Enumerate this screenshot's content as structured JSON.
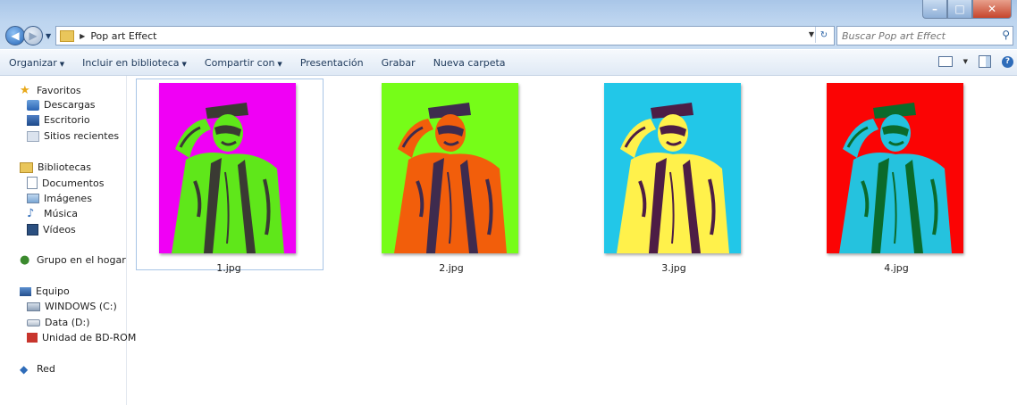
{
  "address": {
    "path": "Pop art Effect"
  },
  "search": {
    "placeholder": "Buscar Pop art Effect"
  },
  "toolbar": {
    "organize": "Organizar",
    "include_library": "Incluir en biblioteca",
    "share": "Compartir con",
    "slideshow": "Presentación",
    "burn": "Grabar",
    "new_folder": "Nueva carpeta"
  },
  "nav": {
    "favorites": "Favoritos",
    "downloads": "Descargas",
    "desktop": "Escritorio",
    "recent": "Sitios recientes",
    "libraries": "Bibliotecas",
    "documents": "Documentos",
    "images": "Imágenes",
    "music": "Música",
    "videos": "Vídeos",
    "homegroup": "Grupo en el hogar",
    "computer": "Equipo",
    "drive_c": "WINDOWS (C:)",
    "drive_d": "Data (D:)",
    "drive_bd": "Unidad de BD-ROM",
    "network": "Red"
  },
  "files": [
    {
      "name": "1.jpg",
      "bg": "#f000f5",
      "figure": "#5fe71a",
      "shadow": "#3a3a33"
    },
    {
      "name": "2.jpg",
      "bg": "#76fd18",
      "figure": "#f25e0b",
      "shadow": "#3e2b4e"
    },
    {
      "name": "3.jpg",
      "bg": "#22c7e8",
      "figure": "#fff14b",
      "shadow": "#4d1d45"
    },
    {
      "name": "4.jpg",
      "bg": "#fb0404",
      "figure": "#25c2de",
      "shadow": "#0b6a2b"
    }
  ],
  "colors": {
    "selection_border": "#a8c5e6",
    "command_text": "#1e395b"
  }
}
